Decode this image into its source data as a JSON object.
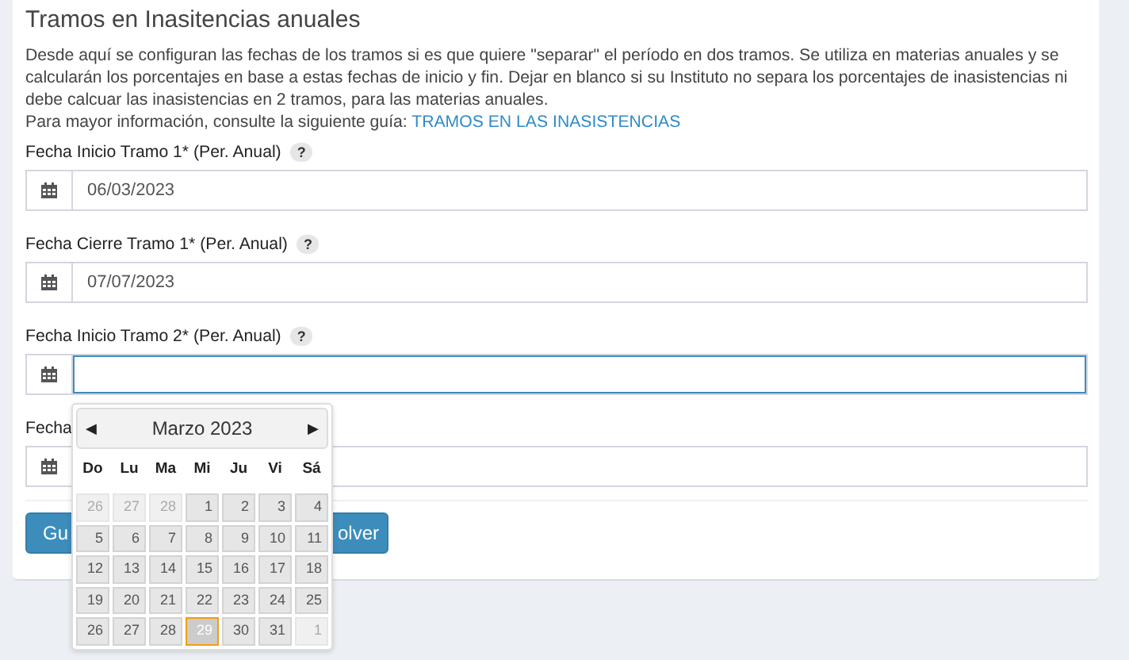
{
  "section": {
    "title": "Tramos en Inasitencias anuales",
    "description": "Desde aquí se configuran las fechas de los tramos si es que quiere \"separar\" el período en dos tramos. Se utiliza en materias anuales y se calcularán los porcentajes en base a estas fechas de inicio y fin. Dejar en blanco si su Instituto no separa los porcentajes de inasistencias ni debe calcuar las inasistencias en 2 tramos, para las materias anuales.",
    "guide_prefix": "Para mayor información, consulte la siguiente guía:",
    "guide_link": "TRAMOS EN LAS INASISTENCIAS"
  },
  "fields": [
    {
      "label": "Fecha Inicio Tramo 1* (Per. Anual)",
      "help": "?",
      "value": "06/03/2023",
      "focused": false
    },
    {
      "label": "Fecha Cierre Tramo 1* (Per. Anual)",
      "help": "?",
      "value": "07/07/2023",
      "focused": false
    },
    {
      "label": "Fecha Inicio Tramo 2* (Per. Anual)",
      "help": "?",
      "focused": true
    },
    {
      "label": "Fecha",
      "focused": false
    }
  ],
  "buttons": [
    "Gu",
    "olver"
  ],
  "datepicker": {
    "prev": "◀",
    "next": "▶",
    "month": "Marzo 2023",
    "weekdays": [
      "Do",
      "Lu",
      "Ma",
      "Mi",
      "Ju",
      "Vi",
      "Sá"
    ],
    "days": [
      {
        "label": "26",
        "muted": true,
        "selected": false
      },
      {
        "label": "27",
        "muted": true,
        "selected": false
      },
      {
        "label": "28",
        "muted": true,
        "selected": false
      },
      {
        "label": "1",
        "muted": false,
        "selected": false
      },
      {
        "label": "2",
        "muted": false,
        "selected": false
      },
      {
        "label": "3",
        "muted": false,
        "selected": false
      },
      {
        "label": "4",
        "muted": false,
        "selected": false
      },
      {
        "label": "5",
        "muted": false,
        "selected": false
      },
      {
        "label": "6",
        "muted": false,
        "selected": false
      },
      {
        "label": "7",
        "muted": false,
        "selected": false
      },
      {
        "label": "8",
        "muted": false,
        "selected": false
      },
      {
        "label": "9",
        "muted": false,
        "selected": false
      },
      {
        "label": "10",
        "muted": false,
        "selected": false
      },
      {
        "label": "11",
        "muted": false,
        "selected": false
      },
      {
        "label": "12",
        "muted": false,
        "selected": false
      },
      {
        "label": "13",
        "muted": false,
        "selected": false
      },
      {
        "label": "14",
        "muted": false,
        "selected": false
      },
      {
        "label": "15",
        "muted": false,
        "selected": false
      },
      {
        "label": "16",
        "muted": false,
        "selected": false
      },
      {
        "label": "17",
        "muted": false,
        "selected": false
      },
      {
        "label": "18",
        "muted": false,
        "selected": false
      },
      {
        "label": "19",
        "muted": false,
        "selected": false
      },
      {
        "label": "20",
        "muted": false,
        "selected": false
      },
      {
        "label": "21",
        "muted": false,
        "selected": false
      },
      {
        "label": "22",
        "muted": false,
        "selected": false
      },
      {
        "label": "23",
        "muted": false,
        "selected": false
      },
      {
        "label": "24",
        "muted": false,
        "selected": false
      },
      {
        "label": "25",
        "muted": false,
        "selected": false
      },
      {
        "label": "26",
        "muted": false,
        "selected": false
      },
      {
        "label": "27",
        "muted": false,
        "selected": false
      },
      {
        "label": "28",
        "muted": false,
        "selected": false
      },
      {
        "label": "29",
        "muted": false,
        "selected": true
      },
      {
        "label": "30",
        "muted": false,
        "selected": false
      },
      {
        "label": "31",
        "muted": false,
        "selected": false
      },
      {
        "label": "1",
        "muted": true,
        "selected": false
      }
    ]
  }
}
